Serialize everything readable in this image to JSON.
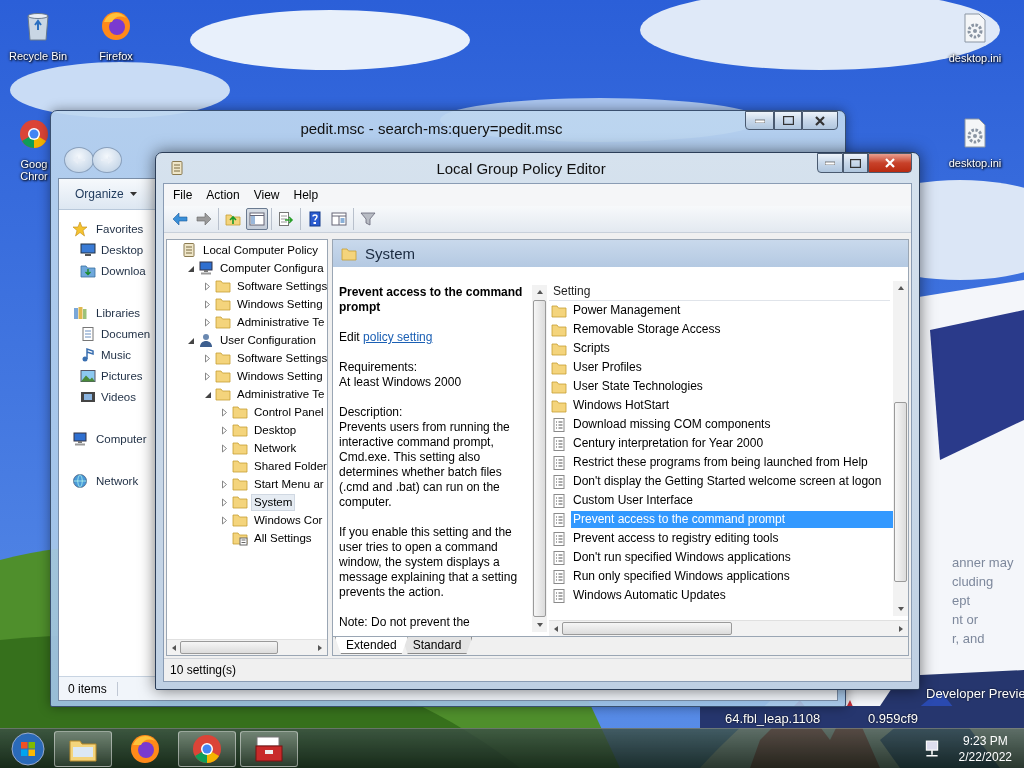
{
  "desktop_icons": [
    {
      "kind": "recycle-bin",
      "lines": [
        "Recycle Bin"
      ]
    },
    {
      "kind": "chrome",
      "lines": [
        "Goog",
        "Chror"
      ]
    },
    {
      "kind": "firefox",
      "lines": [
        "Firefox"
      ]
    },
    {
      "kind": "ini-file",
      "lines": [
        "desktop.ini"
      ]
    },
    {
      "kind": "ini-file",
      "lines": [
        "desktop.ini"
      ]
    }
  ],
  "desktop_notes": [
    "anner may",
    "cluding",
    "ept",
    "nt or",
    "r, and"
  ],
  "build_watermark": [
    "Developer Previe",
    "64.fbl_leap.1108",
    "0.959cf9"
  ],
  "explorer": {
    "title": "pedit.msc - search-ms:query=pedit.msc",
    "organize": "Organize",
    "nav": [
      {
        "kind": "star",
        "label": "Favorites",
        "children": [
          {
            "kind": "desktop",
            "label": "Desktop"
          },
          {
            "kind": "download",
            "label": "Downloa"
          }
        ]
      },
      {
        "kind": "library",
        "label": "Libraries",
        "children": [
          {
            "kind": "documents",
            "label": "Documen"
          },
          {
            "kind": "music",
            "label": "Music"
          },
          {
            "kind": "pictures",
            "label": "Pictures"
          },
          {
            "kind": "videos",
            "label": "Videos"
          }
        ]
      },
      {
        "kind": "computer",
        "label": "Computer"
      },
      {
        "kind": "network",
        "label": "Network"
      }
    ],
    "status": "0 items"
  },
  "gpedit": {
    "title": "Local Group Policy Editor",
    "menus": [
      "File",
      "Action",
      "View",
      "Help"
    ],
    "toolbar_groups": [
      {
        "buttons": [
          {
            "kind": "back",
            "pressed": false
          },
          {
            "kind": "forward",
            "pressed": false
          }
        ]
      },
      {
        "buttons": [
          {
            "kind": "up",
            "pressed": false
          },
          {
            "kind": "panel",
            "pressed": true
          }
        ]
      },
      {
        "buttons": [
          {
            "kind": "export",
            "pressed": false
          }
        ]
      },
      {
        "buttons": [
          {
            "kind": "help",
            "pressed": false
          },
          {
            "kind": "properties",
            "pressed": false
          }
        ]
      },
      {
        "buttons": [
          {
            "kind": "filter",
            "pressed": false
          }
        ]
      }
    ],
    "tree": [
      {
        "kind": "scroll",
        "label": "Local Computer Policy",
        "selected": false,
        "children": [
          {
            "kind": "computer",
            "label": "Computer Configura",
            "expanded": true,
            "selected": false,
            "children": [
              {
                "kind": "folder",
                "label": "Software Settings",
                "expanded": false,
                "selected": false
              },
              {
                "kind": "folder",
                "label": "Windows Setting",
                "expanded": false,
                "selected": false
              },
              {
                "kind": "folder",
                "label": "Administrative Te",
                "expanded": false,
                "selected": false
              }
            ]
          },
          {
            "kind": "user",
            "label": "User Configuration",
            "expanded": true,
            "selected": false,
            "children": [
              {
                "kind": "folder",
                "label": "Software Settings",
                "expanded": false,
                "selected": false
              },
              {
                "kind": "folder",
                "label": "Windows Setting",
                "expanded": false,
                "selected": false
              },
              {
                "kind": "folder",
                "label": "Administrative Te",
                "expanded": true,
                "selected": false,
                "children": [
                  {
                    "kind": "folder",
                    "label": "Control Panel",
                    "expanded": false,
                    "selected": false
                  },
                  {
                    "kind": "folder",
                    "label": "Desktop",
                    "expanded": false,
                    "selected": false
                  },
                  {
                    "kind": "folder",
                    "label": "Network",
                    "expanded": false,
                    "selected": false
                  },
                  {
                    "kind": "folder",
                    "label": "Shared Folder",
                    "selected": false
                  },
                  {
                    "kind": "folder",
                    "label": "Start Menu ar",
                    "expanded": false,
                    "selected": false
                  },
                  {
                    "kind": "folder",
                    "label": "System",
                    "expanded": false,
                    "selected": true
                  },
                  {
                    "kind": "folder",
                    "label": "Windows Cor",
                    "expanded": false,
                    "selected": false
                  },
                  {
                    "kind": "settings",
                    "label": "All Settings",
                    "selected": false
                  }
                ]
              }
            ]
          }
        ]
      }
    ],
    "header": "System",
    "description": {
      "title": "Prevent access to the command prompt",
      "edit_prefix": "Edit",
      "edit_link": "policy setting",
      "paragraphs": [
        {
          "heading": "Requirements:",
          "text": "At least Windows 2000"
        },
        {
          "heading": "Description:",
          "text": "Prevents users from running the interactive command prompt, Cmd.exe. This setting also determines whether batch files (.cmd and .bat) can run on the computer."
        },
        {
          "text": "If you enable this setting and the user tries to open a command window, the system displays a message explaining that a setting prevents the action."
        },
        {
          "text": "Note: Do not prevent the"
        }
      ]
    },
    "column": "Setting",
    "rows": [
      {
        "kind": "folder",
        "label": "Power Management",
        "selected": false
      },
      {
        "kind": "folder",
        "label": "Removable Storage Access",
        "selected": false
      },
      {
        "kind": "folder",
        "label": "Scripts",
        "selected": false
      },
      {
        "kind": "folder",
        "label": "User Profiles",
        "selected": false
      },
      {
        "kind": "folder",
        "label": "User State Technologies",
        "selected": false
      },
      {
        "kind": "folder",
        "label": "Windows HotStart",
        "selected": false
      },
      {
        "kind": "policy",
        "label": "Download missing COM components",
        "selected": false
      },
      {
        "kind": "policy",
        "label": "Century interpretation for Year 2000",
        "selected": false
      },
      {
        "kind": "policy",
        "label": "Restrict these programs from being launched from Help",
        "selected": false
      },
      {
        "kind": "policy",
        "label": "Don't display the Getting Started welcome screen at logon",
        "selected": false
      },
      {
        "kind": "policy",
        "label": "Custom User Interface",
        "selected": false
      },
      {
        "kind": "policy",
        "label": "Prevent access to the command prompt",
        "selected": true
      },
      {
        "kind": "policy",
        "label": "Prevent access to registry editing tools",
        "selected": false
      },
      {
        "kind": "policy",
        "label": "Don't run specified Windows applications",
        "selected": false
      },
      {
        "kind": "policy",
        "label": "Run only specified Windows applications",
        "selected": false
      },
      {
        "kind": "policy",
        "label": "Windows Automatic Updates",
        "selected": false
      }
    ],
    "tabs": [
      {
        "label": "Extended",
        "selected": true
      },
      {
        "label": "Standard",
        "selected": false
      }
    ],
    "status": "10 setting(s)"
  },
  "taskbar": {
    "buttons": [
      {
        "kind": "explorer",
        "running": true
      },
      {
        "kind": "firefox",
        "running": false
      },
      {
        "kind": "chrome",
        "running": true
      },
      {
        "kind": "toolbox",
        "running": true
      }
    ],
    "time": "9:23 PM",
    "date": "2/22/2022"
  }
}
